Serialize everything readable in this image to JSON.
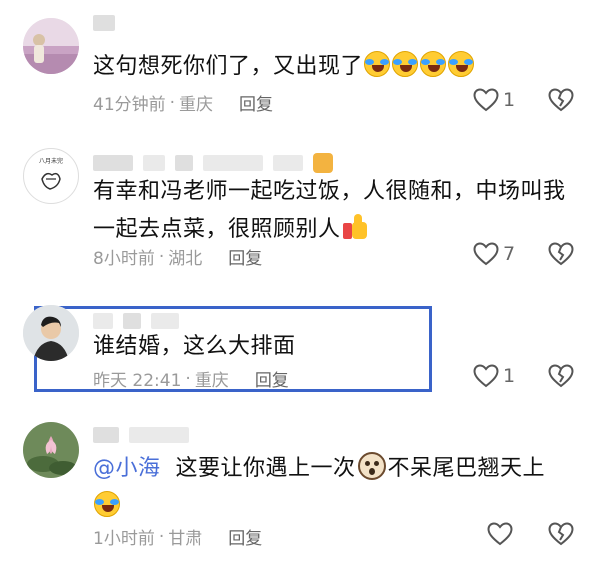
{
  "comments": [
    {
      "text_before": "这句想死你们了，又出现了",
      "emoji_count": 4,
      "time": "41分钟前",
      "location": "重庆",
      "reply": "回复",
      "likes": "1"
    },
    {
      "text_line1": "有幸和冯老师一起吃过饭，人很随和，中场叫我",
      "text_line2": "一起去点菜，很照顾别人",
      "time": "8小时前",
      "location": "湖北",
      "reply": "回复",
      "likes": "7"
    },
    {
      "text": "谁结婚，这么大排面",
      "time": "昨天 22:41",
      "location": "重庆",
      "reply": "回复",
      "likes": "1"
    },
    {
      "mention": "@小海",
      "text_mid": "这要让你遇上一次",
      "text_end": "不呆尾巴翘天上",
      "time": "1小时前",
      "location": "甘肃",
      "reply": "回复",
      "likes": ""
    }
  ],
  "avatar2_text": "八月未完",
  "dot": "·",
  "icons": [
    "heart-outline-icon",
    "broken-heart-icon",
    "laughing-crying-emoji",
    "thumbs-up-emoji",
    "dog-face-emoji"
  ],
  "colors": {
    "highlight": "#3a63c9",
    "mention": "#4a6fd8",
    "meta": "#9a9a9a"
  }
}
